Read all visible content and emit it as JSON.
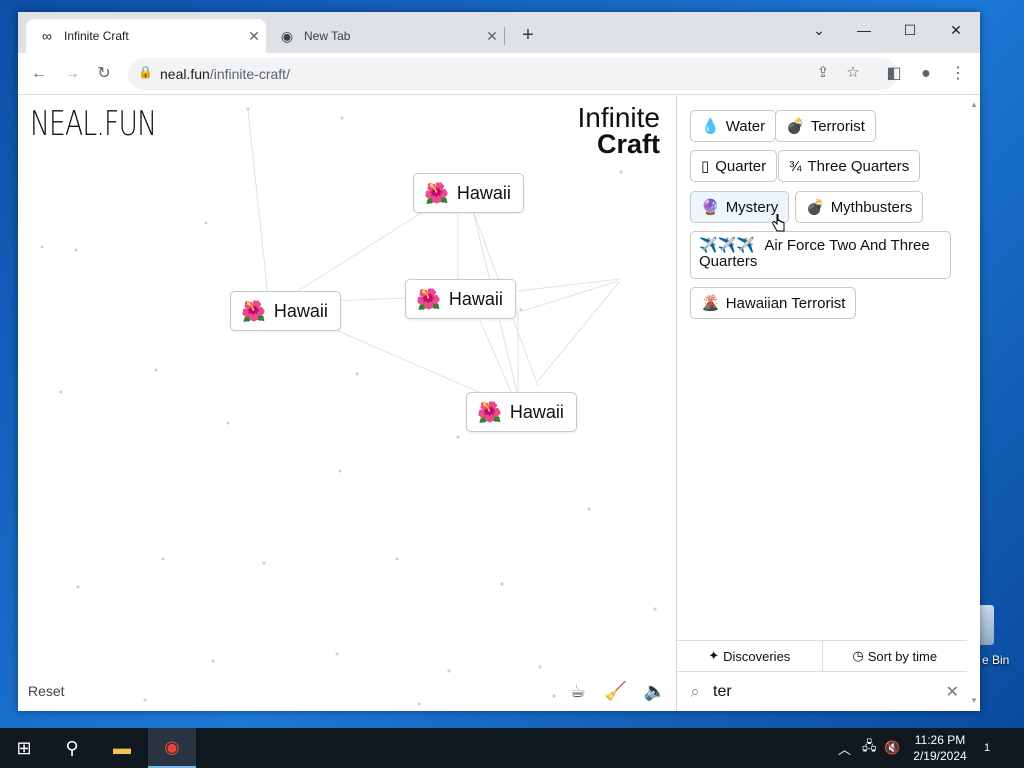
{
  "browser": {
    "tabs": [
      {
        "title": "Infinite Craft",
        "favicon": "infinity-icon",
        "active": true
      },
      {
        "title": "New Tab",
        "favicon": "chrome-icon",
        "active": false
      }
    ],
    "url_host": "neal.fun",
    "url_path": "/infinite-craft/",
    "controls": {
      "minimize": "—",
      "maximize": "☐",
      "close": "✕",
      "tab_search": "⌄"
    }
  },
  "page": {
    "logo_left": "NEAL.FUN",
    "logo_right_line1": "Infinite",
    "logo_right_line2": "Craft",
    "reset_label": "Reset",
    "canvas_items": [
      {
        "name": "Hawaii",
        "emoji": "🌺"
      },
      {
        "name": "Hawaii",
        "emoji": "🌺"
      },
      {
        "name": "Hawaii",
        "emoji": "🌺"
      },
      {
        "name": "Hawaii",
        "emoji": "🌺"
      }
    ]
  },
  "sidebar": {
    "items": [
      {
        "name": "Water",
        "emoji": "💧"
      },
      {
        "name": "Terrorist",
        "emoji": "💣"
      },
      {
        "name": "Quarter",
        "emoji": "▯"
      },
      {
        "name": "Three Quarters",
        "emoji": "¾"
      },
      {
        "name": "Mystery",
        "emoji": "🔮"
      },
      {
        "name": "Mythbusters",
        "emoji": "💣"
      },
      {
        "name": "Air Force Two And Three Quarters",
        "emoji": "✈️✈️✈️"
      },
      {
        "name": "Hawaiian Terrorist",
        "emoji": "🌋"
      }
    ],
    "discoveries_label": "Discoveries",
    "sort_label": "Sort by time",
    "search_value": "ter"
  },
  "desktop": {
    "recycle_bin_label": "e Bin"
  },
  "taskbar": {
    "time": "11:26 PM",
    "date": "2/19/2024",
    "notification_count": "1"
  }
}
